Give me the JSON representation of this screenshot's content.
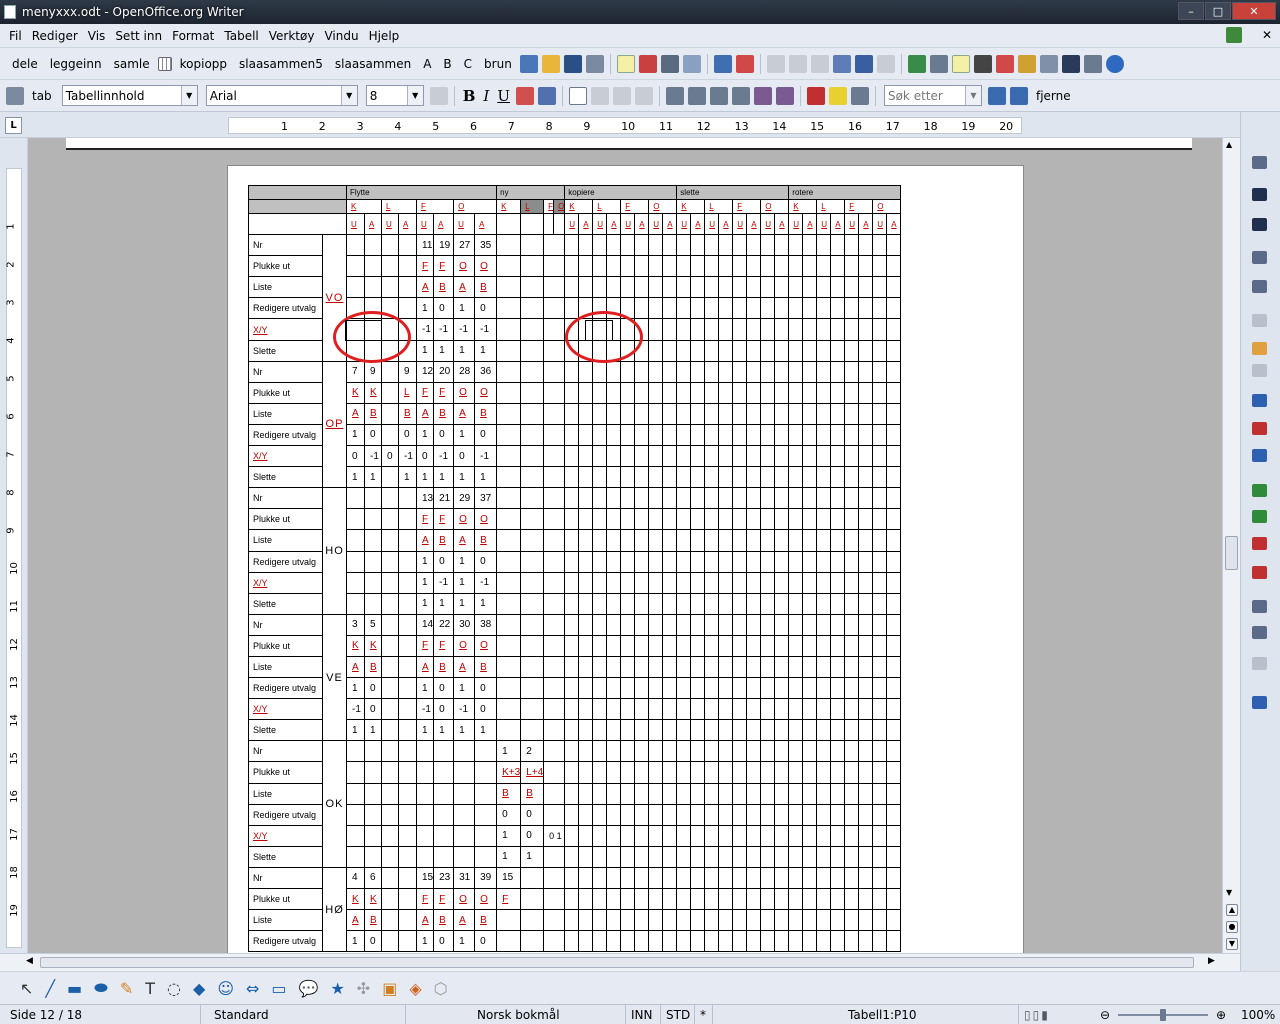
{
  "title": "menyxxx.odt - OpenOffice.org Writer",
  "window": {
    "min": "–",
    "max": "□",
    "close": "✕"
  },
  "menu": [
    "Fil",
    "Rediger",
    "Vis",
    "Sett inn",
    "Format",
    "Tabell",
    "Verktøy",
    "Vindu",
    "Hjelp"
  ],
  "menu_close": "✕",
  "toolbar1": {
    "labels": [
      "dele",
      "leggeinn",
      "samle",
      "kopiopp",
      "slaasammen5",
      "slaasammen",
      "A",
      "B",
      "C",
      "brun"
    ]
  },
  "toolbar2": {
    "tab": "tab",
    "style": "Tabellinnhold",
    "font": "Arial",
    "size": "8",
    "search_placeholder": "Søk etter",
    "fjerne": "fjerne",
    "bold": "B",
    "italic": "I",
    "underline": "U"
  },
  "ruler": {
    "box": "L",
    "ticks": [
      "1",
      "2",
      "3",
      "4",
      "5",
      "6",
      "7",
      "8",
      "9",
      "10",
      "11",
      "12",
      "13",
      "14",
      "15",
      "16",
      "17",
      "18",
      "19",
      "20"
    ]
  },
  "vruler": [
    "1",
    "2",
    "3",
    "4",
    "5",
    "6",
    "7",
    "8",
    "9",
    "10",
    "11",
    "12",
    "13",
    "14",
    "15",
    "16",
    "17",
    "18",
    "19"
  ],
  "table": {
    "sections": [
      "Flytte",
      "ny",
      "kopiere",
      "slette",
      "rotere"
    ],
    "sub_flytte": [
      "K",
      "L",
      "F",
      "O"
    ],
    "sub_ny": [
      "K",
      "L",
      "F",
      "O"
    ],
    "sub_kopiere": [
      "K",
      "L",
      "F",
      "O"
    ],
    "sub_slette": [
      "K",
      "L",
      "F",
      "O"
    ],
    "sub_rotere": [
      "K",
      "L",
      "F",
      "O"
    ],
    "ua": [
      "U",
      "A"
    ],
    "row_labels": [
      "Nr",
      "Plukke ut",
      "Liste",
      "Redigere utvalg",
      "X/Y",
      "Slette"
    ],
    "groups": [
      {
        "name": "VO",
        "rows": [
          [
            "",
            "",
            "",
            "",
            "11",
            "19",
            "27",
            "35",
            "",
            ""
          ],
          [
            "",
            "",
            "",
            "",
            "F",
            "F",
            "O",
            "O",
            "",
            ""
          ],
          [
            "",
            "",
            "",
            "",
            "A",
            "B",
            "A",
            "B",
            "",
            ""
          ],
          [
            "",
            "",
            "",
            "",
            "1",
            "0",
            "1",
            "0",
            "",
            ""
          ],
          [
            "",
            "",
            "",
            "",
            "-1",
            "-1",
            "-1",
            "-1",
            "",
            ""
          ],
          [
            "",
            "",
            "",
            "",
            "1",
            "1",
            "1",
            "1",
            "",
            ""
          ]
        ]
      },
      {
        "name": "OP",
        "rows": [
          [
            "7",
            "9",
            "",
            "9",
            "12",
            "20",
            "28",
            "36",
            "",
            ""
          ],
          [
            "K",
            "K",
            "",
            "L",
            "F",
            "F",
            "O",
            "O",
            "",
            ""
          ],
          [
            "A",
            "B",
            "",
            "B",
            "A",
            "B",
            "A",
            "B",
            "",
            ""
          ],
          [
            "1",
            "0",
            "",
            "0",
            "1",
            "0",
            "1",
            "0",
            "",
            ""
          ],
          [
            "0",
            "-1",
            "0",
            "-1",
            "0",
            "-1",
            "0",
            "-1",
            "",
            ""
          ],
          [
            "1",
            "1",
            "",
            "1",
            "1",
            "1",
            "1",
            "1",
            "",
            ""
          ]
        ]
      },
      {
        "name": "HO",
        "rows": [
          [
            "",
            "",
            "",
            "",
            "13",
            "21",
            "29",
            "37",
            "",
            ""
          ],
          [
            "",
            "",
            "",
            "",
            "F",
            "F",
            "O",
            "O",
            "",
            ""
          ],
          [
            "",
            "",
            "",
            "",
            "A",
            "B",
            "A",
            "B",
            "",
            ""
          ],
          [
            "",
            "",
            "",
            "",
            "1",
            "0",
            "1",
            "0",
            "",
            ""
          ],
          [
            "",
            "",
            "",
            "",
            "1",
            "-1",
            "1",
            "-1",
            "",
            ""
          ],
          [
            "",
            "",
            "",
            "",
            "1",
            "1",
            "1",
            "1",
            "",
            ""
          ]
        ]
      },
      {
        "name": "VE",
        "rows": [
          [
            "3",
            "5",
            "",
            "",
            "14",
            "22",
            "30",
            "38",
            "",
            ""
          ],
          [
            "K",
            "K",
            "",
            "",
            "F",
            "F",
            "O",
            "O",
            "",
            ""
          ],
          [
            "A",
            "B",
            "",
            "",
            "A",
            "B",
            "A",
            "B",
            "",
            ""
          ],
          [
            "1",
            "0",
            "",
            "",
            "1",
            "0",
            "1",
            "0",
            "",
            ""
          ],
          [
            "-1",
            "0",
            "",
            "",
            "-1",
            "0",
            "-1",
            "0",
            "",
            ""
          ],
          [
            "1",
            "1",
            "",
            "",
            "1",
            "1",
            "1",
            "1",
            "",
            ""
          ]
        ]
      },
      {
        "name": "OK",
        "rows": [
          [
            "",
            "",
            "",
            "",
            "",
            "",
            "",
            "",
            "1",
            "2"
          ],
          [
            "",
            "",
            "",
            "",
            "",
            "",
            "",
            "",
            "K+3",
            "L+4"
          ],
          [
            "",
            "",
            "",
            "",
            "",
            "",
            "",
            "",
            "B",
            "B"
          ],
          [
            "",
            "",
            "",
            "",
            "",
            "",
            "",
            "",
            "0",
            "0"
          ],
          [
            "",
            "",
            "",
            "",
            "",
            "",
            "",
            "",
            "1",
            "0",
            "0 1"
          ],
          [
            "",
            "",
            "",
            "",
            "",
            "",
            "",
            "",
            "1",
            "1"
          ]
        ]
      },
      {
        "name": "HØ",
        "rows": [
          [
            "4",
            "6",
            "",
            "",
            "15",
            "23",
            "31",
            "39",
            "15",
            ""
          ],
          [
            "K",
            "K",
            "",
            "",
            "F",
            "F",
            "O",
            "O",
            "F",
            ""
          ],
          [
            "A",
            "B",
            "",
            "",
            "A",
            "B",
            "A",
            "B",
            "",
            ""
          ],
          [
            "1",
            "0",
            "",
            "",
            "1",
            "0",
            "1",
            "0",
            "",
            ""
          ]
        ]
      }
    ]
  },
  "status": {
    "page": "Side 12 / 18",
    "style": "Standard",
    "lang": "Norsk bokmål",
    "ins": "INN",
    "std": "STD",
    "mod": "*",
    "cell": "Tabell1:P10",
    "zoom": "100%"
  }
}
